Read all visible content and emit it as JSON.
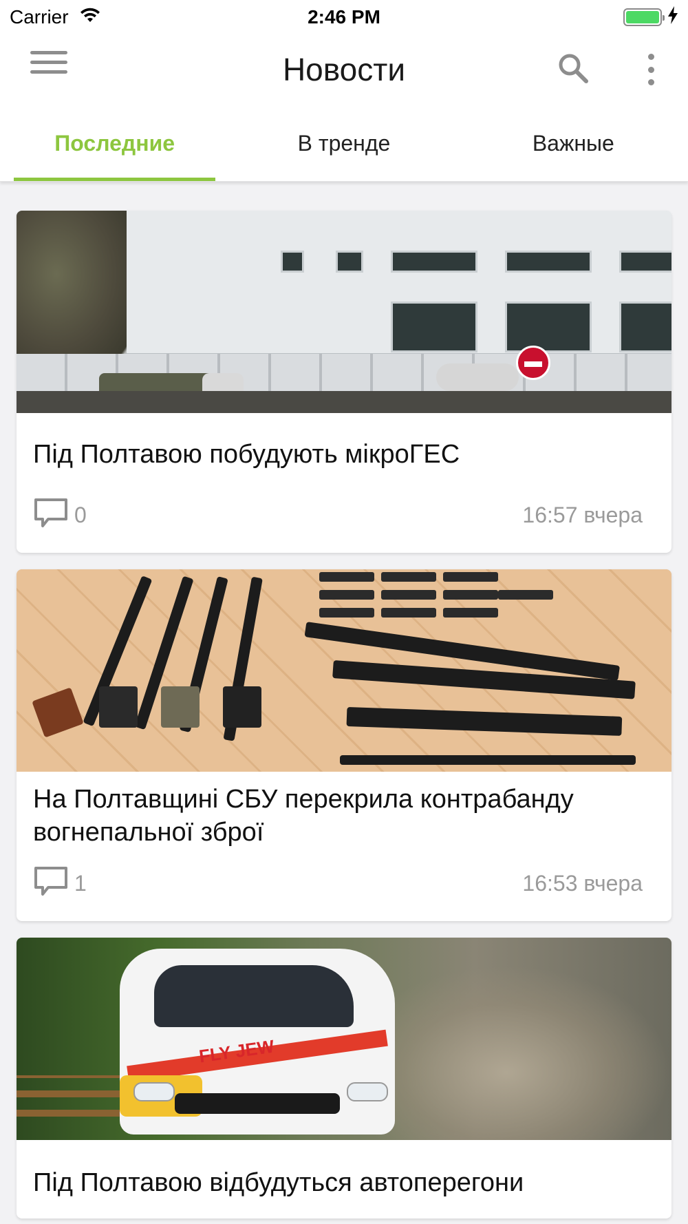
{
  "status_bar": {
    "carrier": "Carrier",
    "time": "2:46 PM",
    "battery_level": 1.0,
    "battery_color": "#4cd964"
  },
  "app_bar": {
    "title": "Новости",
    "icons": [
      "menu-icon",
      "search-icon",
      "more-vertical-icon"
    ]
  },
  "tabs": [
    {
      "label": "Последние",
      "active": true
    },
    {
      "label": "В тренде",
      "active": false
    },
    {
      "label": "Важные",
      "active": false
    }
  ],
  "accent_color": "#8dc63f",
  "articles": [
    {
      "title": "Під Полтавою побудують мікроГЕС",
      "comment_count": "0",
      "time": "16:57 вчера",
      "image": "building-photo"
    },
    {
      "title": "На Полтавщині СБУ перекрила контрабанду вогнепальної зброї",
      "comment_count": "1",
      "time": "16:53 вчера",
      "image": "guns-photo"
    },
    {
      "title": "Під Полтавою відбудуться автоперегони",
      "image": "rally-car-photo",
      "image_text": "FLY JEW"
    }
  ]
}
